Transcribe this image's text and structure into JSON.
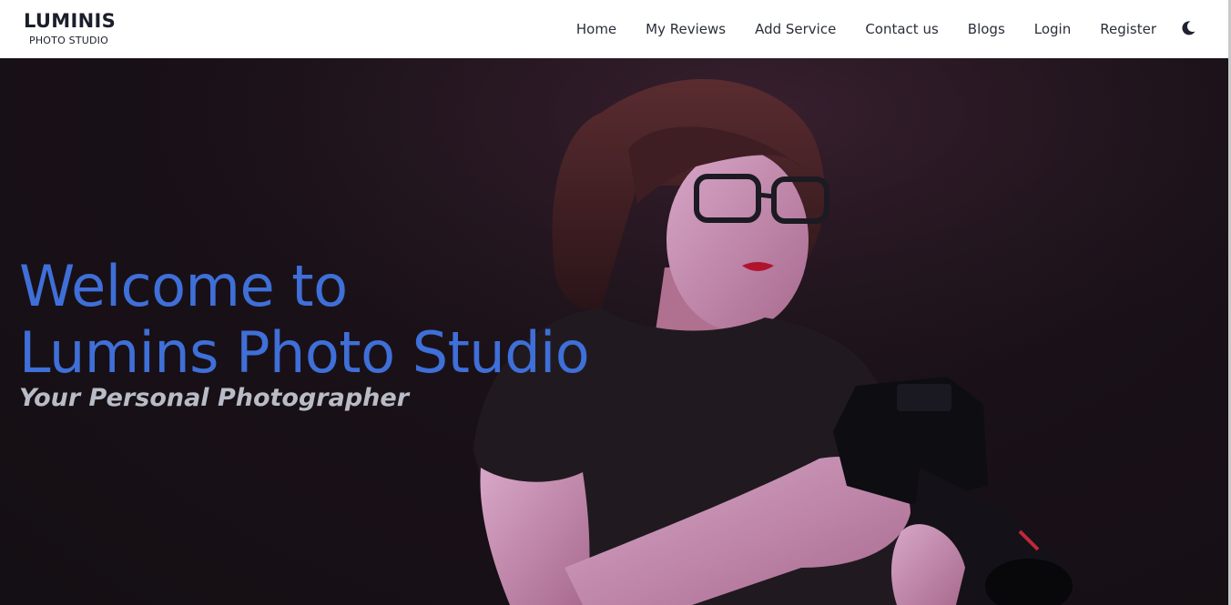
{
  "brand": {
    "name": "LUMINIS",
    "tagline": "PHOTO STUDIO"
  },
  "nav": {
    "items": [
      {
        "label": "Home"
      },
      {
        "label": "My Reviews"
      },
      {
        "label": "Add Service"
      },
      {
        "label": "Contact us"
      },
      {
        "label": "Blogs"
      },
      {
        "label": "Login"
      },
      {
        "label": "Register"
      }
    ],
    "theme_toggle_icon": "moon-icon"
  },
  "hero": {
    "title_line1": "Welcome to",
    "title_line2": "Lumins Photo Studio",
    "subtitle": "Your Personal Photographer",
    "image_icon": "photographer-with-camera-image"
  },
  "colors": {
    "title": "#3f6fd8",
    "subtitle": "#b9bcc6",
    "hero_background": "#1a1118",
    "navbar": "#ffffff"
  }
}
